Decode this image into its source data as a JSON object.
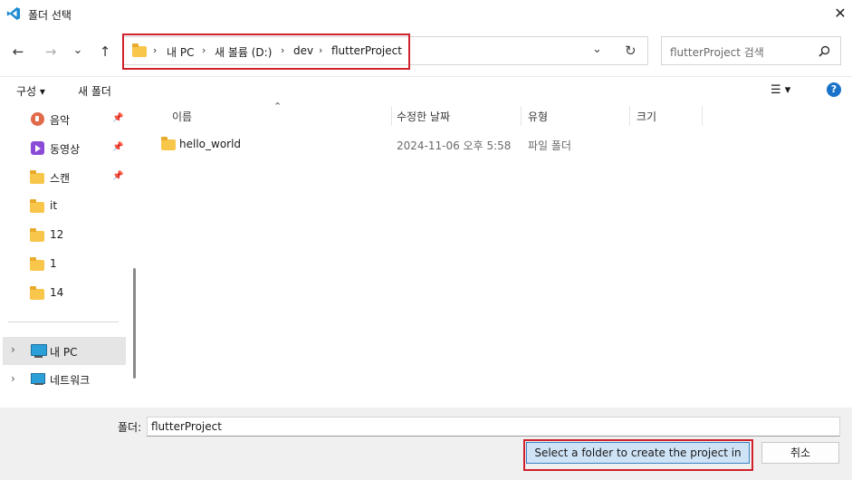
{
  "window": {
    "title": "폴더 선택",
    "close_glyph": "✕"
  },
  "nav": {
    "back": "←",
    "forward": "→",
    "recent": "⌄",
    "up": "↑"
  },
  "address": {
    "crumbs": [
      "내 PC",
      "새 볼륨 (D:)",
      "dev",
      "flutterProject"
    ],
    "separator": "›",
    "dropdown": "⌄",
    "refresh": "↻"
  },
  "search": {
    "placeholder": "flutterProject 검색",
    "icon": "search-icon"
  },
  "toolbar": {
    "organize_label": "구성 ▾",
    "new_folder_label": "새 폴더",
    "view_glyph": "☰ ▾",
    "help_label": "?"
  },
  "sidebar": {
    "items": [
      {
        "label": "음악",
        "icon": "music-icon",
        "pinned": true
      },
      {
        "label": "동영상",
        "icon": "video-icon",
        "pinned": true
      },
      {
        "label": "스캔",
        "icon": "folder-icon",
        "pinned": true
      },
      {
        "label": "it",
        "icon": "folder-icon",
        "pinned": false
      },
      {
        "label": "12",
        "icon": "folder-icon",
        "pinned": false
      },
      {
        "label": "1",
        "icon": "folder-icon",
        "pinned": false
      },
      {
        "label": "14",
        "icon": "folder-icon",
        "pinned": false
      }
    ],
    "roots": [
      {
        "label": "내 PC",
        "icon": "pc-icon",
        "selected": true
      },
      {
        "label": "네트워크",
        "icon": "network-icon",
        "selected": false
      }
    ],
    "expand_glyph": "›",
    "pin_glyph": "📌"
  },
  "file_list": {
    "columns": [
      "이름",
      "수정한 날짜",
      "유형",
      "크기"
    ],
    "sort_glyph": "⌃",
    "rows": [
      {
        "name": "hello_world",
        "modified": "2024-11-06 오후 5:58",
        "type": "파일 폴더",
        "size": ""
      }
    ]
  },
  "footer": {
    "folder_label": "폴더:",
    "folder_value": "flutterProject",
    "select_button": "Select a folder to create the project in",
    "cancel_button": "취소"
  },
  "colors": {
    "highlight": "#d0202c",
    "accent": "#1a73c8",
    "folder": "#f7c64a"
  }
}
